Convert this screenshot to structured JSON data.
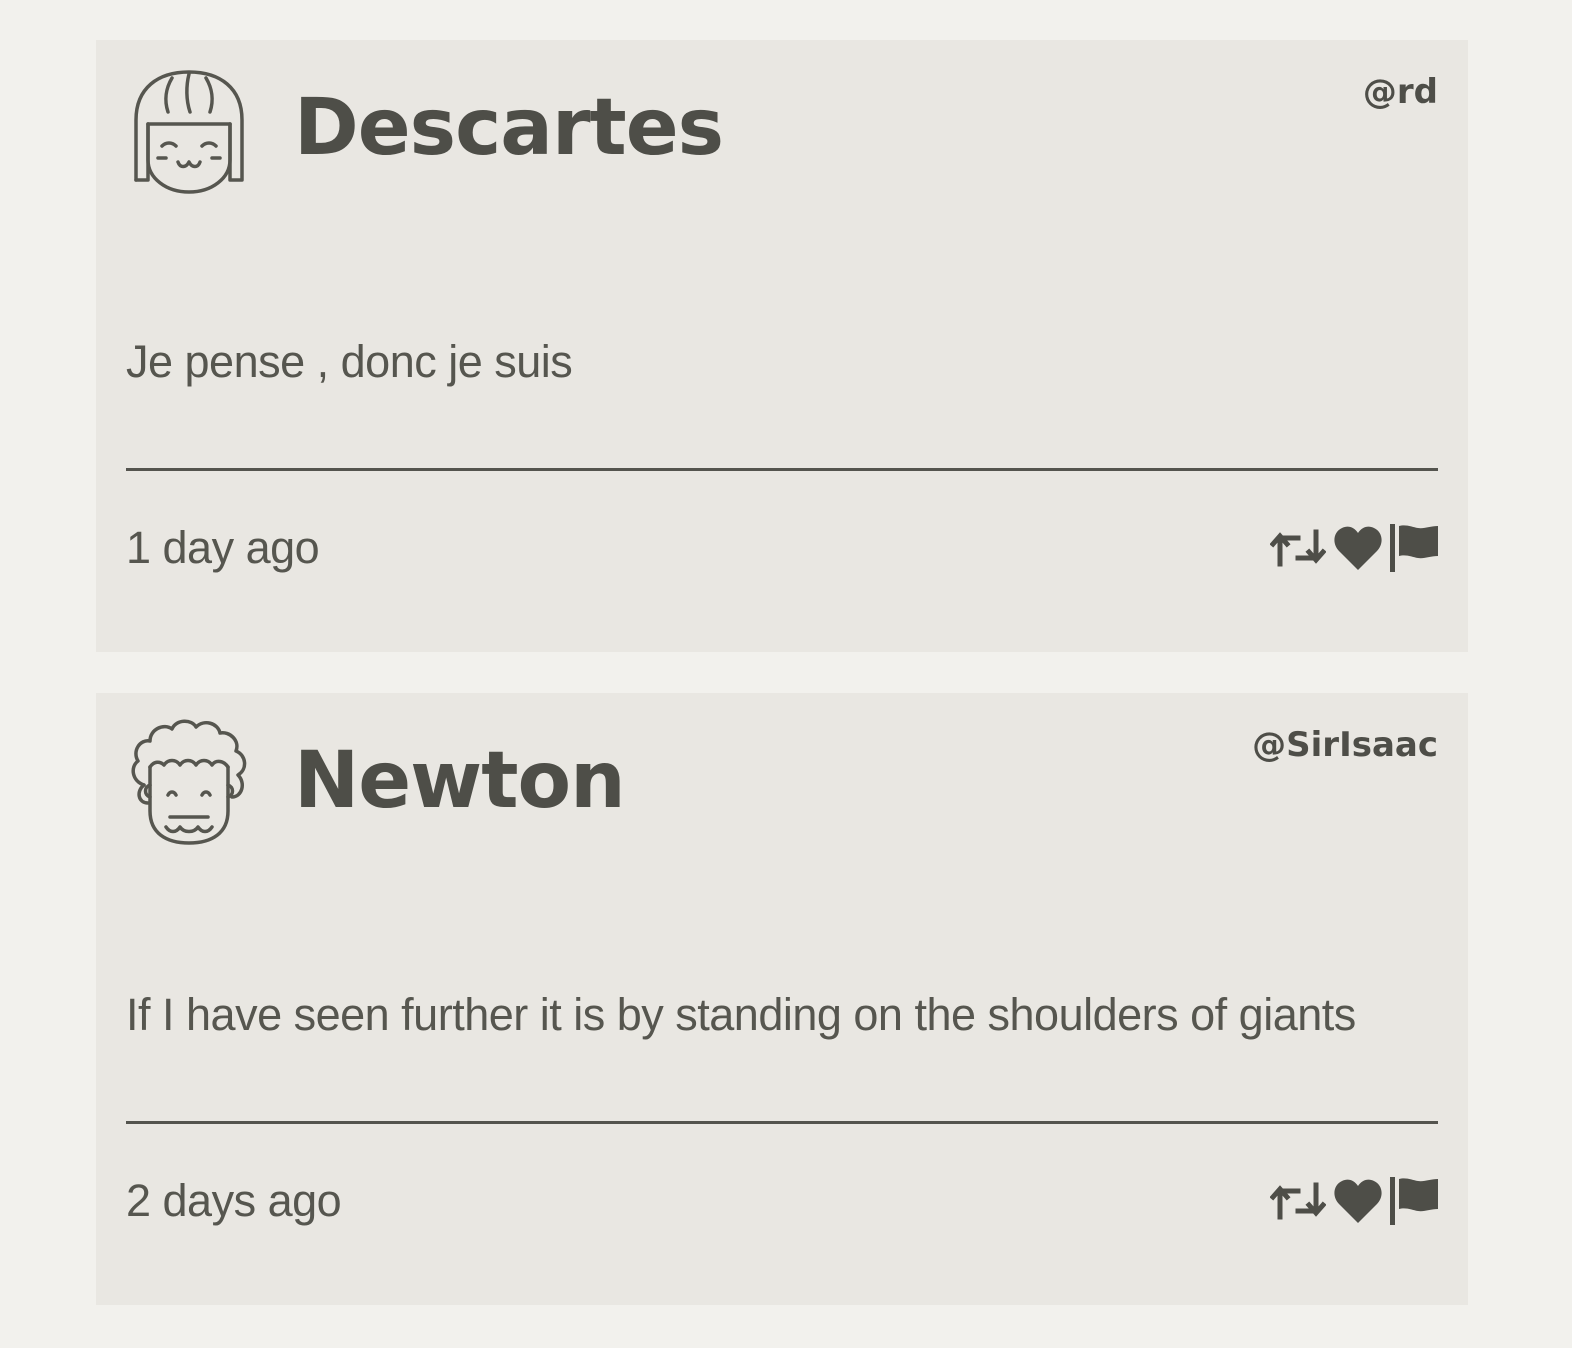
{
  "tweets": [
    {
      "author": "Descartes",
      "handle": "@rd",
      "text": "Je pense , donc je suis",
      "time": "1 day ago",
      "avatar_icon": "girl-face-icon"
    },
    {
      "author": "Newton",
      "handle": "@SirIsaac",
      "text": "If I have seen further it is by standing on the shoulders of giants",
      "time": "2 days ago",
      "avatar_icon": "curly-hair-face-icon"
    }
  ],
  "actions": {
    "retweet_icon": "retweet-icon",
    "like_icon": "heart-icon",
    "flag_icon": "flag-icon"
  },
  "colors": {
    "page_background": "#f2f1ed",
    "card_background": "#e9e7e2",
    "text": "#52524c"
  }
}
